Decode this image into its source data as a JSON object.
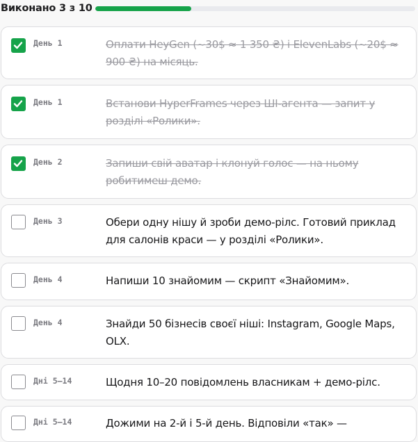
{
  "progress": {
    "label": "Виконано 3 з 10",
    "completed": 3,
    "total": 10,
    "accent_color": "#16a34a"
  },
  "tasks": [
    {
      "day": "День 1",
      "text": "Оплати HeyGen (~30$ ≈ 1 350 ₴) і ElevenLabs (~20$ ≈ 900 ₴) на місяць.",
      "done": true
    },
    {
      "day": "День 1",
      "text": "Встанови HyperFrames через ШІ-агента — запит у розділі «Ролики».",
      "done": true
    },
    {
      "day": "День 2",
      "text": "Запиши свій аватар і клонуй голос — на ньому робитимеш демо.",
      "done": true
    },
    {
      "day": "День 3",
      "text": "Обери одну нішу й зроби демо-рілс. Готовий приклад для салонів краси — у розділі «Ролики».",
      "done": false
    },
    {
      "day": "День 4",
      "text": "Напиши 10 знайомим — скрипт «Знайомим».",
      "done": false
    },
    {
      "day": "День 4",
      "text": "Знайди 50 бізнесів своєї ніші: Instagram, Google Maps, OLX.",
      "done": false
    },
    {
      "day": "Дні 5–14",
      "text": "Щодня 10–20 повідомлень власникам + демо-рілс.",
      "done": false
    },
    {
      "day": "Дні 5–14",
      "text": "Дожими на 2-й і 5-й день. Відповіли «так» —",
      "done": false
    }
  ],
  "icons": {
    "checked": "checkmark-icon"
  }
}
